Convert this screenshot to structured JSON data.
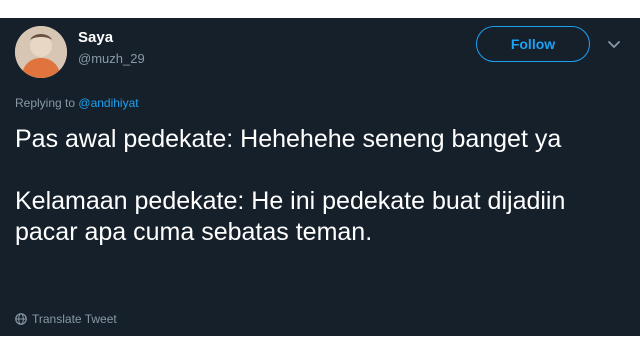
{
  "user": {
    "display_name": "Saya",
    "handle": "@muzh_29"
  },
  "actions": {
    "follow_label": "Follow",
    "menu_icon": "chevron-down-icon"
  },
  "reply": {
    "prefix": "Replying to",
    "mention": "@andihiyat"
  },
  "tweet": {
    "line1": "Pas awal pedekate: Hehehehe seneng banget ya",
    "line2": "Kelamaan pedekate: He ini pedekate buat dijadiin pacar apa cuma sebatas teman."
  },
  "translate": {
    "icon": "globe-icon",
    "label": "Translate Tweet"
  },
  "colors": {
    "background": "#15202b",
    "accent": "#1da1f2",
    "secondary_text": "#8899a6"
  }
}
